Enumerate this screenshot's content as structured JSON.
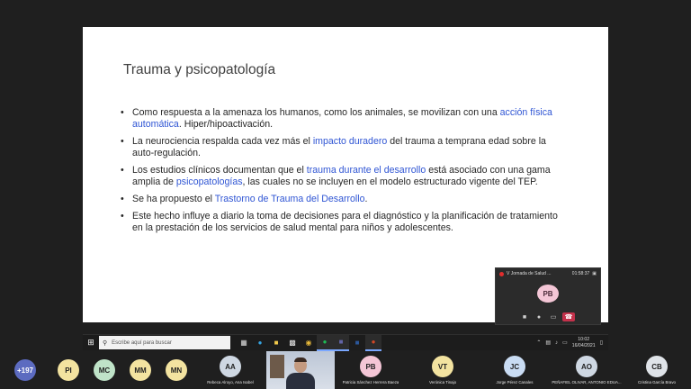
{
  "slide": {
    "title": "Trauma y psicopatología",
    "bullets": [
      {
        "before": "Como respuesta a la amenaza los humanos, como los animales, se movilizan con una ",
        "highlight": "acción física automática",
        "after": ". Hiper/hipoactivación.",
        "extra_highlight": "",
        "extra_after": ""
      },
      {
        "before": "La neurociencia respalda cada vez más el ",
        "highlight": "impacto duradero",
        "after": " del trauma a temprana edad sobre la auto-regulación.",
        "extra_highlight": "",
        "extra_after": ""
      },
      {
        "before": "Los estudios clínicos documentan que el ",
        "highlight": "trauma durante el desarrollo",
        "after": " está asociado con una gama amplia de ",
        "extra_highlight": "psicopatologías",
        "extra_after": ", las cuales no se incluyen en el modelo estructurado vigente del TEP."
      },
      {
        "before": "Se ha propuesto el ",
        "highlight": "Trastorno de Trauma del Desarrollo",
        "after": ".",
        "extra_highlight": "",
        "extra_after": ""
      },
      {
        "before": "Este hecho influye a diario la toma de decisiones para el diagnóstico y la planificación de tratamiento en la prestación de los servicios de salud mental para niños y adolescentes.",
        "highlight": "",
        "after": "",
        "extra_highlight": "",
        "extra_after": ""
      }
    ],
    "highlight_color": "#2f55d4"
  },
  "mini_window": {
    "title": "V Jornada de Salud ...",
    "time": "01:58:37",
    "avatar_initials": "PB",
    "avatar_color": "#f4c6d6"
  },
  "taskbar": {
    "search_placeholder": "Escribe aquí para buscar",
    "apps": [
      "task-view",
      "edge",
      "file-explorer",
      "store",
      "chrome",
      "spotify",
      "teams",
      "word",
      "powerpoint"
    ],
    "time": "10:02",
    "date": "16/04/2021"
  },
  "participants": {
    "more_count": "+197",
    "people": [
      {
        "initials": "PI",
        "name": "",
        "color": "#f3e3a0"
      },
      {
        "initials": "MC",
        "name": "",
        "color": "#bfe3c8"
      },
      {
        "initials": "MM",
        "name": "",
        "color": "#f3e3a0"
      },
      {
        "initials": "MN",
        "name": "",
        "color": "#f3e3a0"
      },
      {
        "initials": "AA",
        "name": "Rebeca Alroyo, Ana Isabel",
        "color": "#cfd8e3"
      },
      {
        "initials": "PB",
        "name": "Patricia Sánchez Herrera Baeza",
        "color": "#f4c6d6"
      },
      {
        "initials": "VT",
        "name": "Verónica Tinajo",
        "color": "#f3e3a0"
      },
      {
        "initials": "JC",
        "name": "Jorge Pérez Canales",
        "color": "#c9dcf3"
      },
      {
        "initials": "AO",
        "name": "PEÑAFIEL OLIVAR, ANTONIO EDUA...",
        "color": "#cfd8e3"
      },
      {
        "initials": "CB",
        "name": "Cristina García Bravo",
        "color": "#dfe3e8"
      }
    ]
  }
}
